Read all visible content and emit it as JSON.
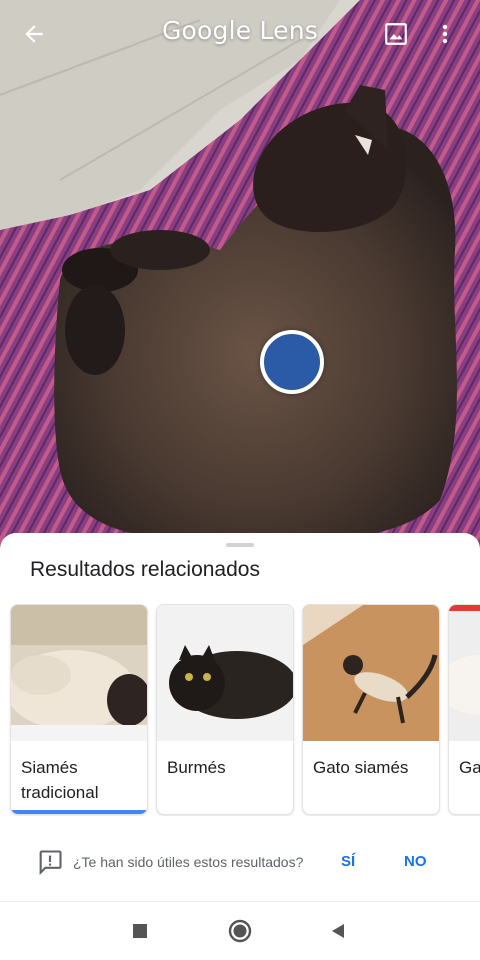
{
  "app": {
    "title": "Google Lens"
  },
  "icons": {
    "back": "arrow-left-icon",
    "gallery": "image-icon",
    "more": "more-vert-icon",
    "feedback": "feedback-icon",
    "nav_recents": "square-icon",
    "nav_home": "circle-icon",
    "nav_back": "triangle-back-icon"
  },
  "colors": {
    "shutter": "#2b5aa6",
    "accent": "#1a73e8",
    "active_tab": "#4285f4"
  },
  "results": {
    "title": "Resultados relacionados",
    "cards": [
      {
        "label": "Siamés tradicional",
        "selected": true
      },
      {
        "label": "Burmés",
        "selected": false
      },
      {
        "label": "Gato siamés",
        "selected": false
      },
      {
        "label": "Ga",
        "selected": false
      }
    ]
  },
  "feedback": {
    "question": "¿Te han sido útiles estos resultados?",
    "yes": "SÍ",
    "no": "NO"
  }
}
